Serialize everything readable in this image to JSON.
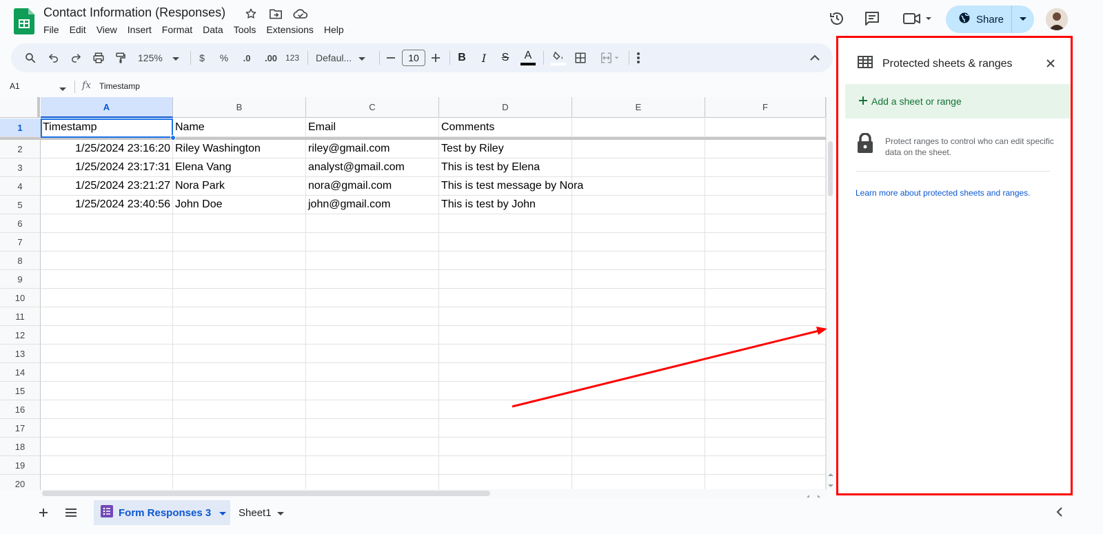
{
  "document": {
    "title": "Contact Information (Responses)",
    "menu": [
      "File",
      "Edit",
      "View",
      "Insert",
      "Format",
      "Data",
      "Tools",
      "Extensions",
      "Help"
    ]
  },
  "header": {
    "share_label": "Share"
  },
  "toolbar": {
    "zoom": "125%",
    "currency": "$",
    "percent": "%",
    "decrease_decimal": ".0",
    "increase_decimal": ".00",
    "number_format": "123",
    "font": "Defaul...",
    "font_size": "10"
  },
  "formula_bar": {
    "cell_ref": "A1",
    "fx": "fx",
    "value": "Timestamp"
  },
  "grid": {
    "columns": [
      "A",
      "B",
      "C",
      "D",
      "E",
      "F"
    ],
    "rows": [
      "1",
      "2",
      "3",
      "4",
      "5",
      "6",
      "7",
      "8",
      "9",
      "10",
      "11",
      "12",
      "13",
      "14",
      "15",
      "16",
      "17",
      "18",
      "19",
      "20"
    ],
    "header_row": [
      "Timestamp",
      "Name",
      "Email",
      "Comments"
    ],
    "data": [
      [
        "1/25/2024 23:16:20",
        "Riley Washington",
        "riley@gmail.com",
        "Test by Riley"
      ],
      [
        "1/25/2024 23:17:31",
        "Elena Vang",
        "analyst@gmail.com",
        "This is test by Elena"
      ],
      [
        "1/25/2024 23:21:27",
        "Nora Park",
        "nora@gmail.com",
        "This is test message by Nora"
      ],
      [
        "1/25/2024 23:40:56",
        "John Doe",
        "john@gmail.com",
        "This is test by John"
      ]
    ]
  },
  "sheets": {
    "active": "Form Responses 3",
    "other": "Sheet1"
  },
  "panel": {
    "title": "Protected sheets & ranges",
    "add_label": "Add a sheet or range",
    "info": "Protect ranges to control who can edit specific data on the sheet.",
    "learn_more": "Learn more about protected sheets and ranges."
  },
  "colors": {
    "accent": "#0b57d0",
    "highlight_border": "#ff0000",
    "add_bg": "#e6f4ea",
    "add_text": "#137333",
    "sheets_green": "#0f9d58"
  }
}
